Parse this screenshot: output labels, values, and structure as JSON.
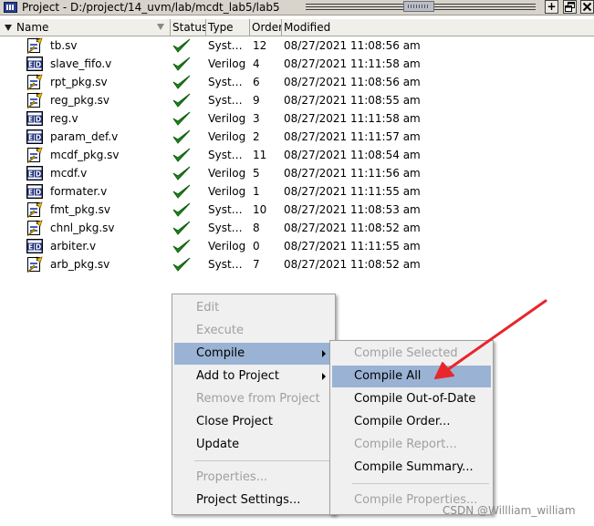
{
  "window": {
    "title": "Project - D:/project/14_uvm/lab/mcdt_lab5/lab5"
  },
  "columns": {
    "name": "Name",
    "status": "Status",
    "type": "Type",
    "order": "Order",
    "modified": "Modified"
  },
  "files": [
    {
      "name": "tb.sv",
      "type": "Syst…",
      "order": "12",
      "modified": "08/27/2021 11:08:56 am",
      "icon": "systemverilog-file-icon"
    },
    {
      "name": "slave_fifo.v",
      "type": "Verilog",
      "order": "4",
      "modified": "08/27/2021 11:11:58 am",
      "icon": "verilog-file-icon"
    },
    {
      "name": "rpt_pkg.sv",
      "type": "Syst…",
      "order": "6",
      "modified": "08/27/2021 11:08:56 am",
      "icon": "systemverilog-file-icon"
    },
    {
      "name": "reg_pkg.sv",
      "type": "Syst…",
      "order": "9",
      "modified": "08/27/2021 11:08:55 am",
      "icon": "systemverilog-file-icon"
    },
    {
      "name": "reg.v",
      "type": "Verilog",
      "order": "3",
      "modified": "08/27/2021 11:11:58 am",
      "icon": "verilog-file-icon"
    },
    {
      "name": "param_def.v",
      "type": "Verilog",
      "order": "2",
      "modified": "08/27/2021 11:11:57 am",
      "icon": "verilog-file-icon"
    },
    {
      "name": "mcdf_pkg.sv",
      "type": "Syst…",
      "order": "11",
      "modified": "08/27/2021 11:08:54 am",
      "icon": "systemverilog-file-icon"
    },
    {
      "name": "mcdf.v",
      "type": "Verilog",
      "order": "5",
      "modified": "08/27/2021 11:11:56 am",
      "icon": "verilog-file-icon"
    },
    {
      "name": "formater.v",
      "type": "Verilog",
      "order": "1",
      "modified": "08/27/2021 11:11:55 am",
      "icon": "verilog-file-icon"
    },
    {
      "name": "fmt_pkg.sv",
      "type": "Syst…",
      "order": "10",
      "modified": "08/27/2021 11:08:53 am",
      "icon": "systemverilog-file-icon"
    },
    {
      "name": "chnl_pkg.sv",
      "type": "Syst…",
      "order": "8",
      "modified": "08/27/2021 11:08:52 am",
      "icon": "systemverilog-file-icon"
    },
    {
      "name": "arbiter.v",
      "type": "Verilog",
      "order": "0",
      "modified": "08/27/2021 11:11:55 am",
      "icon": "verilog-file-icon"
    },
    {
      "name": "arb_pkg.sv",
      "type": "Syst…",
      "order": "7",
      "modified": "08/27/2021 11:08:52 am",
      "icon": "systemverilog-file-icon"
    }
  ],
  "context_menu": {
    "items": [
      {
        "label": "Edit",
        "enabled": false
      },
      {
        "label": "Execute",
        "enabled": false
      },
      {
        "label": "Compile",
        "enabled": true,
        "highlighted": true,
        "submenu": true
      },
      {
        "label": "Add to Project",
        "enabled": true,
        "submenu": true
      },
      {
        "label": "Remove from Project",
        "enabled": false
      },
      {
        "label": "Close Project",
        "enabled": true
      },
      {
        "label": "Update",
        "enabled": true
      },
      {
        "label": "Properties...",
        "enabled": false
      },
      {
        "label": "Project Settings...",
        "enabled": true
      }
    ]
  },
  "compile_submenu": {
    "items": [
      {
        "label": "Compile Selected",
        "enabled": false
      },
      {
        "label": "Compile All",
        "enabled": true,
        "highlighted": true
      },
      {
        "label": "Compile Out-of-Date",
        "enabled": true
      },
      {
        "label": "Compile Order...",
        "enabled": true
      },
      {
        "label": "Compile Report...",
        "enabled": false
      },
      {
        "label": "Compile Summary...",
        "enabled": true
      },
      {
        "label": "Compile Properties...",
        "enabled": false
      }
    ]
  },
  "watermark": "CSDN @Willliam_william",
  "colors": {
    "menu_highlight": "#9ab3d4",
    "annotation_arrow": "#e8262b",
    "status_check": "#1f8a1f"
  }
}
